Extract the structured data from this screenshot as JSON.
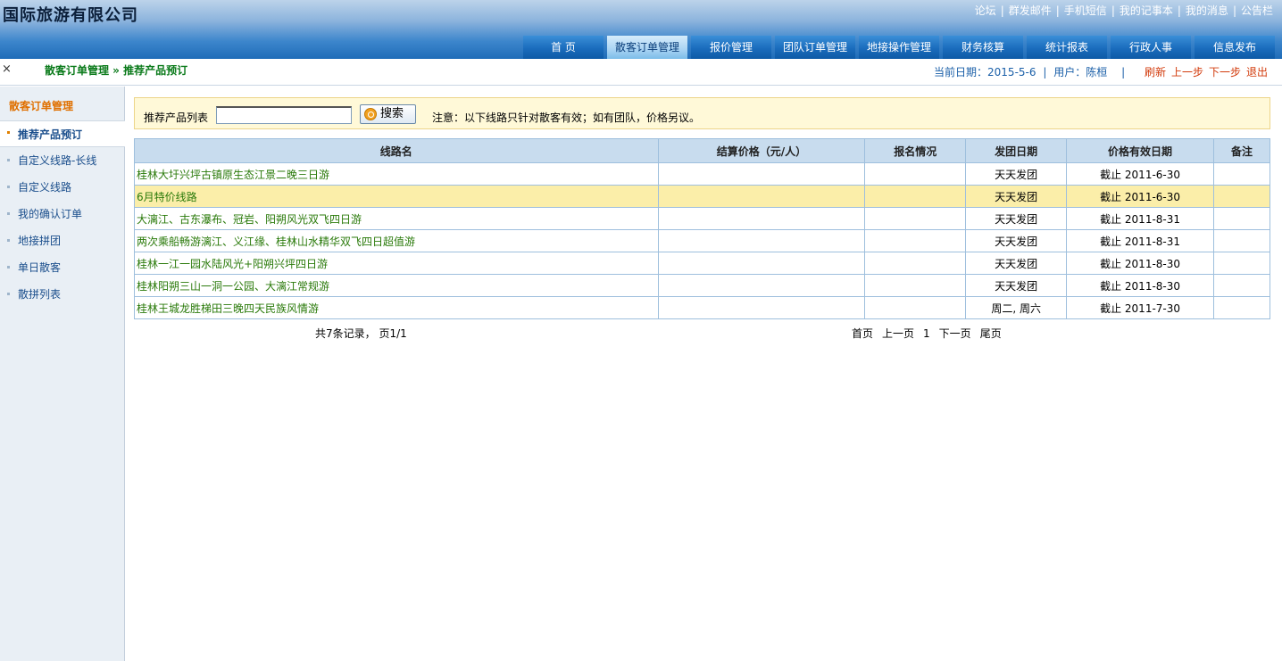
{
  "header": {
    "title": "国际旅游有限公司",
    "top_links": [
      "论坛",
      "群发邮件",
      "手机短信",
      "我的记事本",
      "我的消息",
      "公告栏"
    ],
    "nav_tabs": [
      "首 页",
      "散客订单管理",
      "报价管理",
      "团队订单管理",
      "地接操作管理",
      "财务核算",
      "统计报表",
      "行政人事",
      "信息发布"
    ],
    "active_tab": 1
  },
  "crumb": {
    "close": "×",
    "path": "散客订单管理 » 推荐产品预订",
    "date_label": "当前日期：2015-5-6",
    "user_label": "用户：陈桓",
    "actions": [
      "刷新",
      "上一步",
      "下一步",
      "退出"
    ]
  },
  "sidebar": {
    "title": "散客订单管理",
    "items": [
      "推荐产品预订",
      "自定义线路-长线",
      "自定义线路",
      "我的确认订单",
      "地接拼团",
      "单日散客",
      "散拼列表"
    ],
    "active_index": 0
  },
  "search": {
    "label": "推荐产品列表",
    "input_value": "",
    "button_label": "搜索",
    "note": "注意：以下线路只针对散客有效；如有团队，价格另议。"
  },
  "table": {
    "headers": [
      "线路名",
      "结算价格（元/人）",
      "报名情况",
      "发团日期",
      "价格有效日期",
      "备注"
    ],
    "rows": [
      {
        "name": "桂林大圩兴坪古镇原生态江景二晚三日游",
        "price": "",
        "signup": "",
        "depart": "天天发团",
        "valid": "截止 2011-6-30",
        "note": ""
      },
      {
        "name": "6月特价线路",
        "price": "",
        "signup": "",
        "depart": "天天发团",
        "valid": "截止 2011-6-30",
        "note": ""
      },
      {
        "name": "大漓江、古东瀑布、冠岩、阳朔风光双飞四日游",
        "price": "",
        "signup": "",
        "depart": "天天发团",
        "valid": "截止 2011-8-31",
        "note": ""
      },
      {
        "name": "两次乘船畅游漓江、义江缘、桂林山水精华双飞四日超值游",
        "price": "",
        "signup": "",
        "depart": "天天发团",
        "valid": "截止 2011-8-31",
        "note": ""
      },
      {
        "name": "桂林一江一园水陆风光+阳朔兴坪四日游",
        "price": "",
        "signup": "",
        "depart": "天天发团",
        "valid": "截止 2011-8-30",
        "note": ""
      },
      {
        "name": "桂林阳朔三山一洞一公园、大漓江常规游",
        "price": "",
        "signup": "",
        "depart": "天天发团",
        "valid": "截止 2011-8-30",
        "note": ""
      },
      {
        "name": "桂林王城龙胜梯田三晚四天民族风情游",
        "price": "",
        "signup": "",
        "depart": "周二, 周六",
        "valid": "截止 2011-7-30",
        "note": ""
      }
    ],
    "highlighted_row": 1
  },
  "pager": {
    "summary": "共7条记录， 页1/1",
    "links": [
      "首页",
      "上一页",
      "1",
      "下一页",
      "尾页"
    ]
  }
}
